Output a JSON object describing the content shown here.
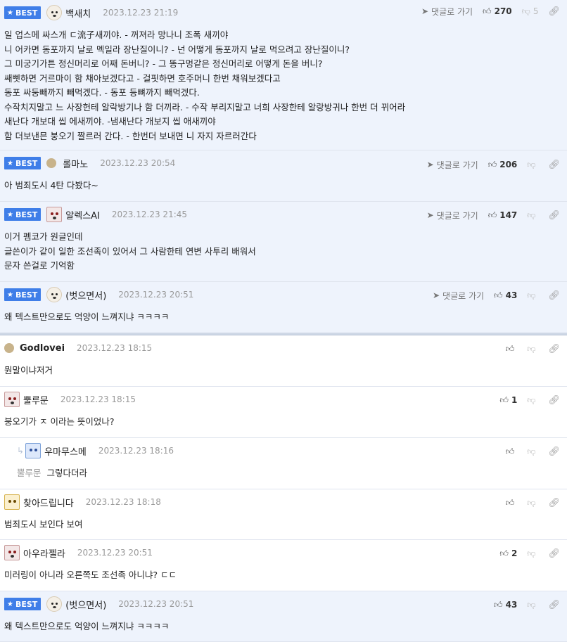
{
  "labels": {
    "best": "BEST",
    "reply": "댓글로 가기"
  },
  "colors": {
    "best_badge": "#3f7ee8",
    "best_bg": "#eef3fc",
    "border": "#dfe4ee"
  },
  "best_comments": [
    {
      "avatar": "dog-icon",
      "nick": "백새치",
      "date": "2023.12.23 21:19",
      "likes": "270",
      "dislikes": "5",
      "lines": [
        "일 업스메 싸스개 ㄷ流子새끼야. - 꺼져라 망나니 조폭 새끼야",
        "니 어카면 동포까지 날로 멕일라 장난질이니? - 넌 어떻게 동포까지 날로 먹으려고 장난질이니?",
        "그 미궁기가튼 정신머리로 어째 돈버니? - 그 똥구멍같은 정신머리로 어떻게 돈을 버니?",
        "쌔삣하면 거르마이 함 채아보겠다고 - 걸핏하면 호주머니 한번 채워보겠다고",
        "동포 싸둥빼까지 빼먹겠다. - 동포 등뼈까지 빼먹겠다.",
        "수작치지말고 느 사장헌테 알락방기나 함 더끼라. - 수작 부리지말고 너희 사장한테 알랑방귀나 한번 더 뀌어라",
        "새난다 개보대 씹 에새끼야. -냄새난다 개보지 씹 애새끼야",
        "함 더보낸믄 붕오기 짤르러 간다. - 한번더 보내면 니 자지 자르러간다"
      ]
    },
    {
      "avatar": "dot-icon",
      "nick": "롤마노",
      "date": "2023.12.23 20:54",
      "likes": "206",
      "dislikes": "",
      "lines": [
        "아 범죄도시 4탄 다봤다~"
      ]
    },
    {
      "avatar": "square-icon",
      "nick": "알렉스AI",
      "date": "2023.12.23 21:45",
      "likes": "147",
      "dislikes": "",
      "lines": [
        "이거 펨코가 원글인데",
        "글쓴이가 같이 일한 조선족이 있어서 그 사람한테 연변 사투리 배워서",
        "문자 쓴걸로 기억함"
      ]
    },
    {
      "avatar": "dog-icon",
      "nick": "(벗으면서)",
      "date": "2023.12.23 20:51",
      "likes": "43",
      "dislikes": "",
      "lines": [
        "왜 텍스트만으로도 억양이 느껴지냐 ㅋㅋㅋㅋ"
      ]
    }
  ],
  "comments": [
    {
      "avatar": "dot-icon",
      "nick": "Godlovei",
      "date": "2023.12.23 18:15",
      "likes": "",
      "lines": [
        "뭔말이냐저거"
      ],
      "reply": false
    },
    {
      "avatar": "square-icon",
      "nick": "뿔루문",
      "date": "2023.12.23 18:15",
      "likes": "1",
      "lines": [
        "붕오기가 ㅈ 이라는 뜻이었나?"
      ],
      "reply": false
    },
    {
      "avatar": "blue-icon",
      "nick": "우마무스메",
      "date": "2023.12.23 18:16",
      "likes": "",
      "mention": "뿔루문",
      "lines": [
        "그렇다더라"
      ],
      "reply": true
    },
    {
      "avatar": "yellow-icon",
      "nick": "찾아드립니다",
      "date": "2023.12.23 18:18",
      "likes": "",
      "lines": [
        "범죄도시 보인다 보여"
      ],
      "reply": false
    },
    {
      "avatar": "square-icon",
      "nick": "아우라젤라",
      "date": "2023.12.23 20:51",
      "likes": "2",
      "lines": [
        "미러링이 아니라 오른쪽도 조선족 아니냐? ㄷㄷ"
      ],
      "reply": false
    },
    {
      "avatar": "dog-icon",
      "nick": "(벗으면서)",
      "date": "2023.12.23 20:51",
      "likes": "43",
      "lines": [
        "왜 텍스트만으로도 억양이 느껴지냐 ㅋㅋㅋㅋ"
      ],
      "reply": false,
      "best": true
    }
  ]
}
